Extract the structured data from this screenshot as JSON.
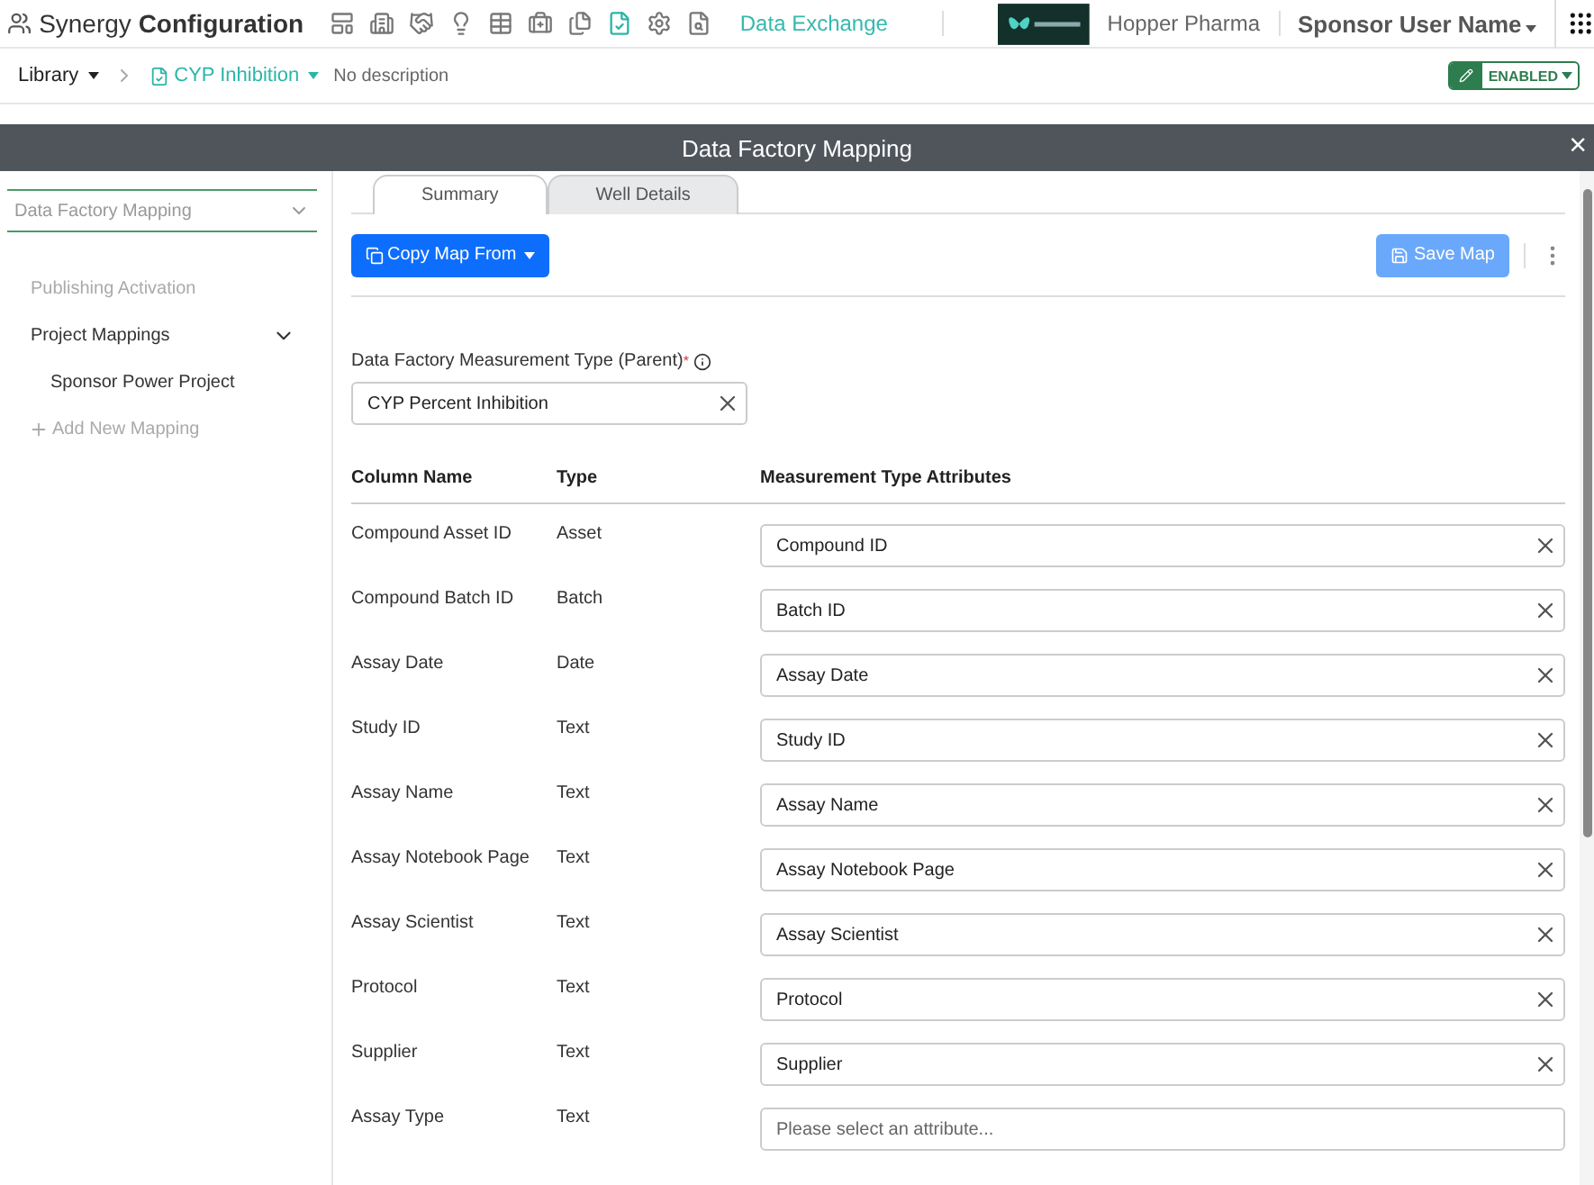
{
  "app": {
    "title_light": "Synergy",
    "title_bold": "Configuration"
  },
  "nav_icons": [
    {
      "selected": false
    },
    {
      "selected": false
    },
    {
      "selected": false
    },
    {
      "selected": false
    },
    {
      "selected": false
    },
    {
      "selected": false
    },
    {
      "selected": false
    },
    {
      "selected": true
    },
    {
      "selected": false
    },
    {
      "selected": false
    }
  ],
  "nav_link": {
    "label": "Data Exchange",
    "selected": true
  },
  "org": "Hopper Pharma",
  "user": "Sponsor User Name",
  "breadcrumb": {
    "library": "Library",
    "item": "CYP Inhibition",
    "description": "No description"
  },
  "status": "ENABLED",
  "modal": {
    "title": "Data Factory Mapping",
    "close": "×"
  },
  "sidebar": {
    "dropdown": "Data Factory Mapping",
    "items": [
      {
        "label": "Publishing Activation",
        "disabled": true
      },
      {
        "label": "Project Mappings",
        "disabled": false,
        "expanded": true,
        "children": [
          {
            "label": "Sponsor Power Project"
          }
        ]
      }
    ],
    "add_link": "Add New Mapping"
  },
  "tabs": [
    {
      "label": "Summary",
      "selected": true
    },
    {
      "label": "Well Details",
      "selected": false
    }
  ],
  "copy_button": "Copy Map From",
  "save_button": {
    "label": "Save Map",
    "disabled": true
  },
  "parent_field": {
    "label": "Data Factory Measurement Type (Parent)",
    "required": "*",
    "value": "CYP Percent Inhibition"
  },
  "table": {
    "columns": [
      "Column Name",
      "Type",
      "Measurement Type Attributes"
    ],
    "rows": [
      {
        "name": "Compound Asset ID",
        "type": "Asset",
        "value": "Compound ID"
      },
      {
        "name": "Compound Batch ID",
        "type": "Batch",
        "value": "Batch ID"
      },
      {
        "name": "Assay Date",
        "type": "Date",
        "value": "Assay Date"
      },
      {
        "name": "Study ID",
        "type": "Text",
        "value": "Study ID"
      },
      {
        "name": "Assay Name",
        "type": "Text",
        "value": "Assay Name"
      },
      {
        "name": "Assay Notebook Page",
        "type": "Text",
        "value": "Assay Notebook Page"
      },
      {
        "name": "Assay Scientist",
        "type": "Text",
        "value": "Assay Scientist"
      },
      {
        "name": "Protocol",
        "type": "Text",
        "value": "Protocol"
      },
      {
        "name": "Supplier",
        "type": "Text",
        "value": "Supplier"
      },
      {
        "name": "Assay Type",
        "type": "Text",
        "placeholder": "Please select an attribute..."
      }
    ]
  }
}
